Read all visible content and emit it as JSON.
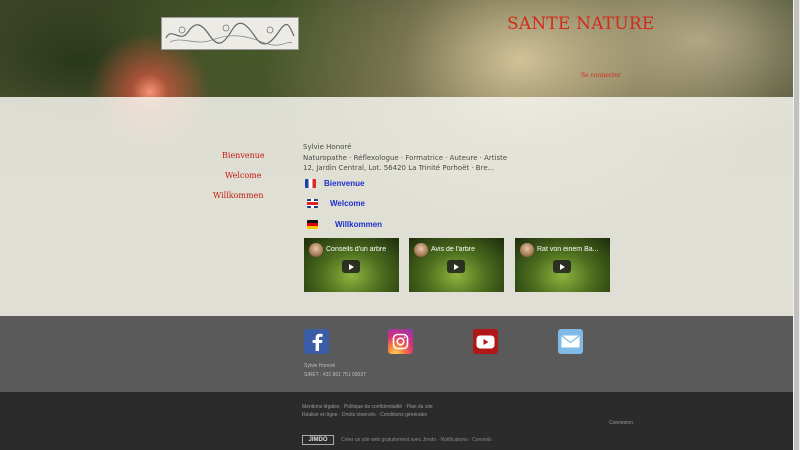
{
  "header": {
    "site_title": "SANTE NATURE",
    "hero_link": "Se connecter"
  },
  "nav": {
    "items": [
      {
        "label": "Bienvenue"
      },
      {
        "label": "Welcome"
      },
      {
        "label": "Willkommen"
      }
    ]
  },
  "info": {
    "name": "Sylvie Honoré",
    "professions": "Naturopathe · Réflexologue · Formatrice · Auteure · Artiste",
    "address": "12, Jardin Central, Lot. 56420 La Trinité Porhoët · Bre..."
  },
  "languages": [
    {
      "label": "Bienvenue",
      "flag": "flag-fr-icon"
    },
    {
      "label": "Welcome",
      "flag": "flag-uk-icon"
    },
    {
      "label": "Willkommen",
      "flag": "flag-de-icon"
    }
  ],
  "videos": [
    {
      "title": "Conseils d'un arbre"
    },
    {
      "title": "Avis de l'arbre"
    },
    {
      "title": "Rat von einem Ba..."
    }
  ],
  "footer": {
    "social": [
      "facebook-icon",
      "instagram-icon",
      "youtube-icon",
      "email-icon"
    ],
    "contact_name": "Sylvie Honoré",
    "siret": "SIRET : 431 861 751 00037",
    "legal_links": "Mentions légales · Politique de confidentialité · Plan du site",
    "copyright": "Réalisé en ligne · Droits réservés · Conditions générales",
    "login": "Connexion",
    "jimdo_badge": "JIMDO",
    "jimdo_text": "Créer un site web gratuitement avec Jimdo · Notifications · Conseils"
  },
  "colors": {
    "accent": "#d42a1a",
    "link_blue": "#1e2fcf",
    "footer": "#5a5a5a",
    "bottom": "#2b2b2b"
  }
}
